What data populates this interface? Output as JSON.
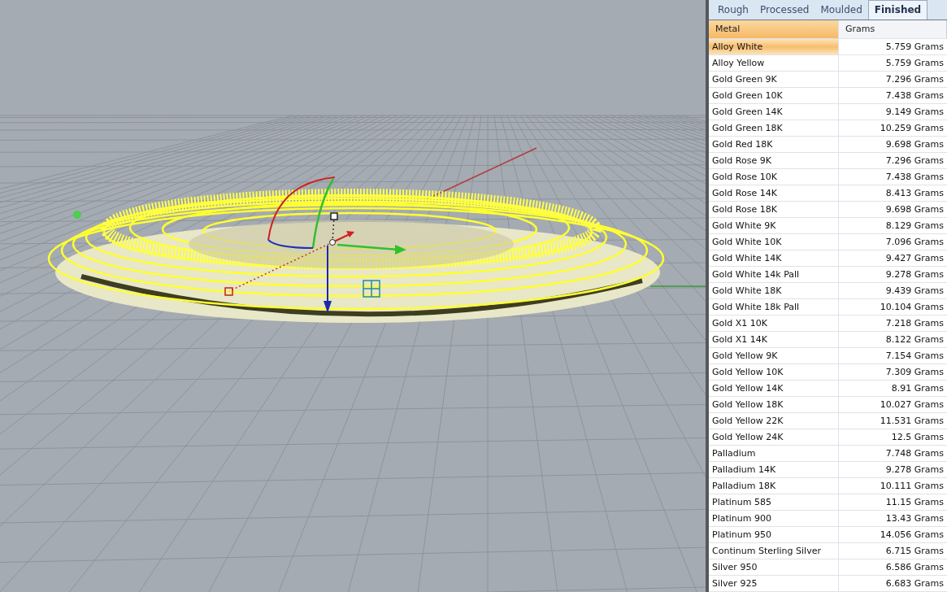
{
  "tabs": [
    {
      "label": "Rough",
      "selected": false
    },
    {
      "label": "Processed",
      "selected": false
    },
    {
      "label": "Moulded",
      "selected": false
    },
    {
      "label": "Finished",
      "selected": true
    }
  ],
  "table": {
    "columns": [
      {
        "label": "Metal",
        "sorted": true
      },
      {
        "label": "Grams",
        "sorted": false
      }
    ],
    "rows": [
      {
        "metal": "Alloy White",
        "grams": "5.759 Grams",
        "selected": true
      },
      {
        "metal": "Alloy Yellow",
        "grams": "5.759 Grams",
        "selected": false
      },
      {
        "metal": "Gold Green 9K",
        "grams": "7.296 Grams",
        "selected": false
      },
      {
        "metal": "Gold Green 10K",
        "grams": "7.438 Grams",
        "selected": false
      },
      {
        "metal": "Gold Green 14K",
        "grams": "9.149 Grams",
        "selected": false
      },
      {
        "metal": "Gold Green 18K",
        "grams": "10.259 Grams",
        "selected": false
      },
      {
        "metal": "Gold Red 18K",
        "grams": "9.698 Grams",
        "selected": false
      },
      {
        "metal": "Gold Rose 9K",
        "grams": "7.296 Grams",
        "selected": false
      },
      {
        "metal": "Gold Rose 10K",
        "grams": "7.438 Grams",
        "selected": false
      },
      {
        "metal": "Gold Rose 14K",
        "grams": "8.413 Grams",
        "selected": false
      },
      {
        "metal": "Gold Rose 18K",
        "grams": "9.698 Grams",
        "selected": false
      },
      {
        "metal": "Gold White 9K",
        "grams": "8.129 Grams",
        "selected": false
      },
      {
        "metal": "Gold White 10K",
        "grams": "7.096 Grams",
        "selected": false
      },
      {
        "metal": "Gold White 14K",
        "grams": "9.427 Grams",
        "selected": false
      },
      {
        "metal": "Gold White 14k Pall",
        "grams": "9.278 Grams",
        "selected": false
      },
      {
        "metal": "Gold White 18K",
        "grams": "9.439 Grams",
        "selected": false
      },
      {
        "metal": "Gold White 18k Pall",
        "grams": "10.104 Grams",
        "selected": false
      },
      {
        "metal": "Gold X1 10K",
        "grams": "7.218 Grams",
        "selected": false
      },
      {
        "metal": "Gold X1 14K",
        "grams": "8.122 Grams",
        "selected": false
      },
      {
        "metal": "Gold Yellow 9K",
        "grams": "7.154 Grams",
        "selected": false
      },
      {
        "metal": "Gold Yellow 10K",
        "grams": "7.309 Grams",
        "selected": false
      },
      {
        "metal": "Gold Yellow 14K",
        "grams": "8.91 Grams",
        "selected": false
      },
      {
        "metal": "Gold Yellow 18K",
        "grams": "10.027 Grams",
        "selected": false
      },
      {
        "metal": "Gold Yellow 22K",
        "grams": "11.531 Grams",
        "selected": false
      },
      {
        "metal": "Gold Yellow 24K",
        "grams": "12.5 Grams",
        "selected": false
      },
      {
        "metal": "Palladium",
        "grams": "7.748 Grams",
        "selected": false
      },
      {
        "metal": "Palladium 14K",
        "grams": "9.278 Grams",
        "selected": false
      },
      {
        "metal": "Palladium 18K",
        "grams": "10.111 Grams",
        "selected": false
      },
      {
        "metal": "Platinum 585",
        "grams": "11.15 Grams",
        "selected": false
      },
      {
        "metal": "Platinum 900",
        "grams": "13.43 Grams",
        "selected": false
      },
      {
        "metal": "Platinum 950",
        "grams": "14.056 Grams",
        "selected": false
      },
      {
        "metal": "Continum Sterling Silver",
        "grams": "6.715 Grams",
        "selected": false
      },
      {
        "metal": "Silver 950",
        "grams": "6.586 Grams",
        "selected": false
      },
      {
        "metal": "Silver 925",
        "grams": "6.683 Grams",
        "selected": false
      }
    ]
  }
}
